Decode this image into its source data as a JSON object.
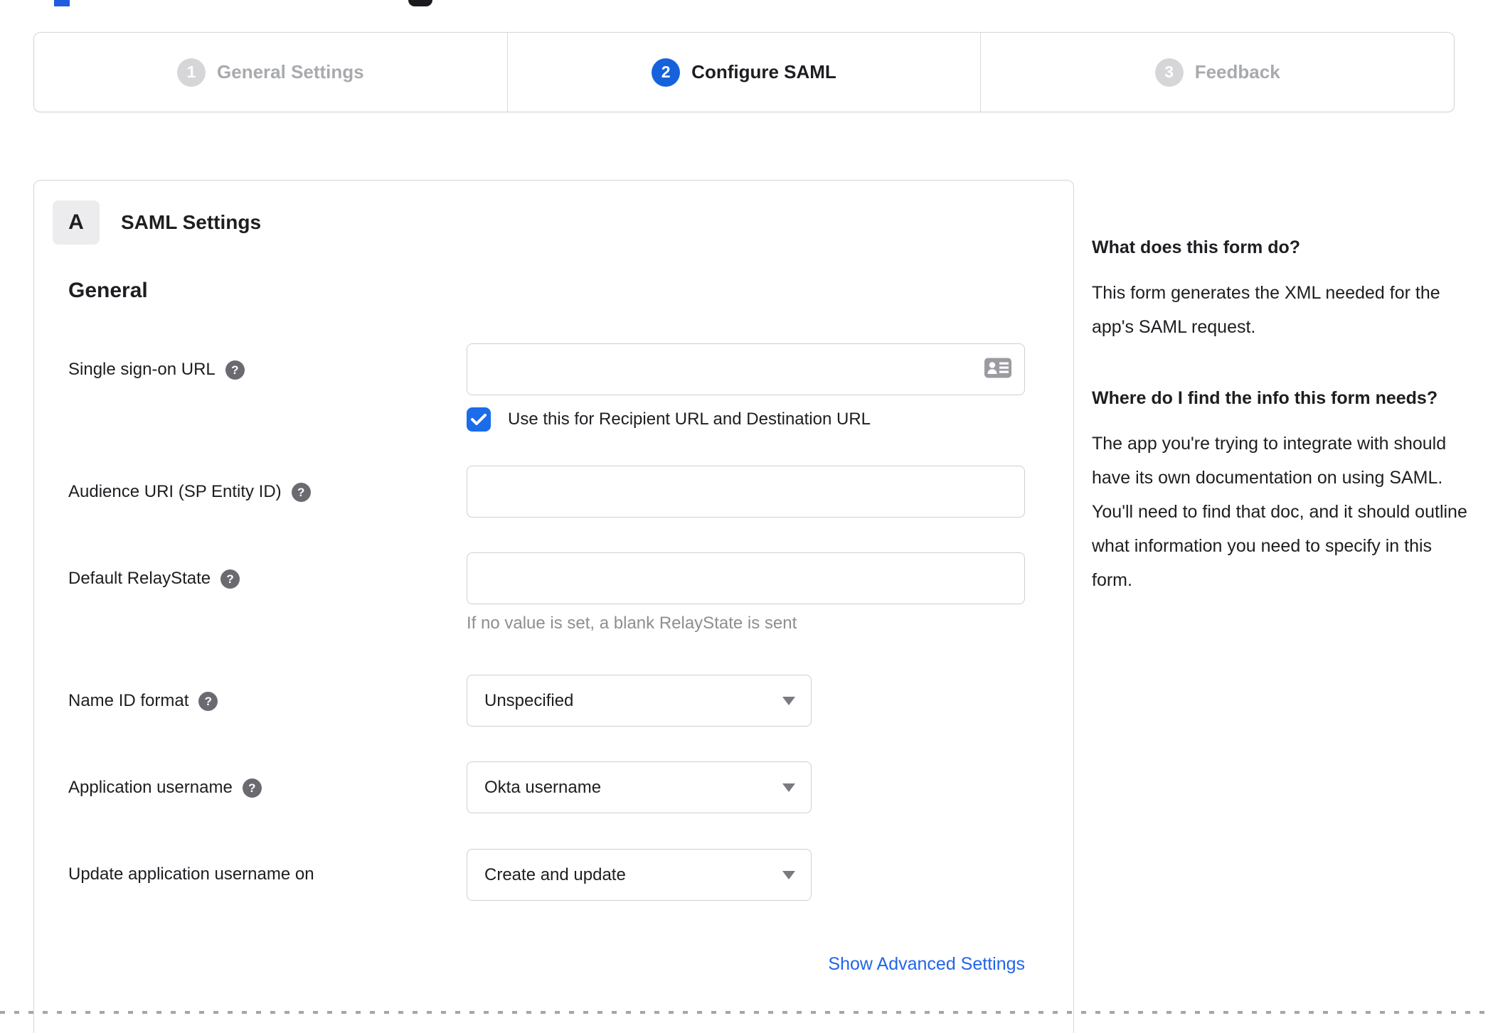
{
  "stepper": {
    "steps": [
      {
        "number": "1",
        "label": "General Settings"
      },
      {
        "number": "2",
        "label": "Configure SAML"
      },
      {
        "number": "3",
        "label": "Feedback"
      }
    ]
  },
  "panel": {
    "badge": "A",
    "title": "SAML Settings",
    "section_heading": "General",
    "fields": {
      "sso": {
        "label": "Single sign-on URL",
        "value": "",
        "checkbox_label": "Use this for Recipient URL and Destination URL",
        "checkbox_checked": "true"
      },
      "audience": {
        "label": "Audience URI (SP Entity ID)",
        "value": ""
      },
      "relay": {
        "label": "Default RelayState",
        "value": "",
        "hint": "If no value is set, a blank RelayState is sent"
      },
      "name_id": {
        "label": "Name ID format",
        "value": "Unspecified"
      },
      "app_username": {
        "label": "Application username",
        "value": "Okta username"
      },
      "update_username": {
        "label": "Update application username on",
        "value": "Create and update"
      }
    },
    "advanced_link": "Show Advanced Settings"
  },
  "sidebar": {
    "q1": "What does this form do?",
    "a1": "This form generates the XML needed for the app's SAML request.",
    "q2": "Where do I find the info this form needs?",
    "a2": "The app you're trying to integrate with should have its own documentation on using SAML. You'll need to find that doc, and it should outline what information you need to specify in this form."
  },
  "colors": {
    "active_step_blue": "#1662dd",
    "checkbox_blue": "#1b6ce8",
    "link_blue": "#2166e8",
    "text_dark": "#1e1e22",
    "hint_gray": "#8e8e93",
    "inactive_gray": "#a8aaae"
  }
}
